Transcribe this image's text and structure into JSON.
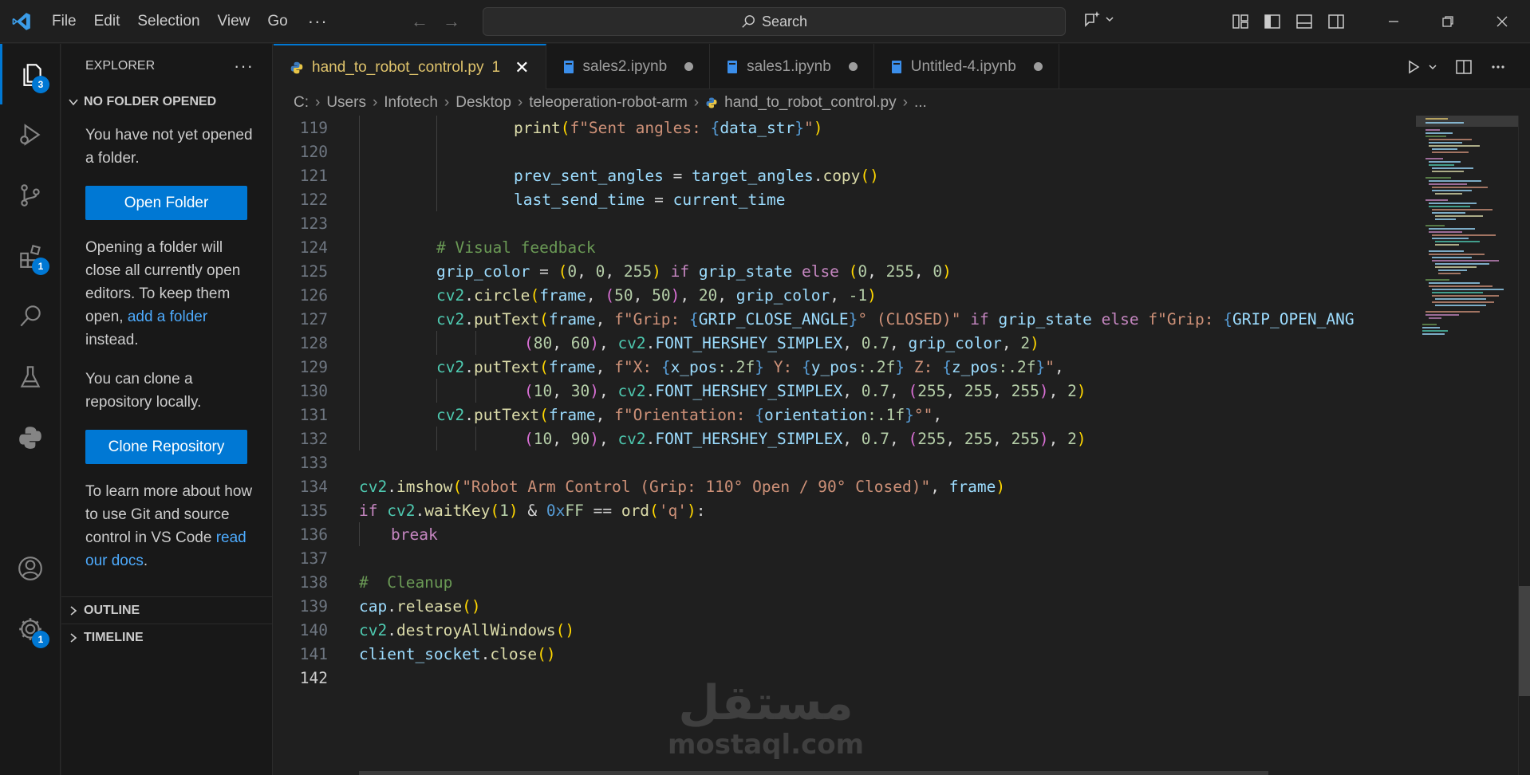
{
  "menu": [
    "File",
    "Edit",
    "Selection",
    "View",
    "Go"
  ],
  "menu_more": "···",
  "search": {
    "label": "Search"
  },
  "activity": {
    "explorer_badge": "3",
    "extensions_badge": "1",
    "manage_badge": "1"
  },
  "sidebar": {
    "title": "EXPLORER",
    "more": "···",
    "section": "NO FOLDER OPENED",
    "msg1": "You have not yet opened a folder.",
    "open_folder": "Open Folder",
    "msg2_a": "Opening a folder will close all currently open editors. To keep them open, ",
    "msg2_link": "add a folder",
    "msg2_b": " instead.",
    "msg3": "You can clone a repository locally.",
    "clone": "Clone Repository",
    "msg4_a": "To learn more about how to use Git and source control in VS Code ",
    "msg4_link": "read our docs",
    "msg4_b": ".",
    "outline": "OUTLINE",
    "timeline": "TIMELINE"
  },
  "tabs": [
    {
      "label": "hand_to_robot_control.py",
      "num": "1",
      "close": "✕"
    },
    {
      "label": "sales2.ipynb"
    },
    {
      "label": "sales1.ipynb"
    },
    {
      "label": "Untitled-4.ipynb"
    }
  ],
  "breadcrumb": [
    "C:",
    "Users",
    "Infotech",
    "Desktop",
    "teleoperation-robot-arm",
    "hand_to_robot_control.py",
    "..."
  ],
  "line_numbers": [
    "119",
    "120",
    "121",
    "122",
    "123",
    "124",
    "125",
    "126",
    "127",
    "128",
    "129",
    "130",
    "131",
    "132",
    "133",
    "134",
    "135",
    "136",
    "137",
    "138",
    "139",
    "140",
    "141",
    "142"
  ],
  "code": {
    "l119": [
      "print",
      "(",
      "f\"Sent angles: ",
      "{",
      "data_str",
      "}",
      "\"",
      ")"
    ],
    "l121": [
      "prev_sent_angles",
      " = ",
      "target_angles",
      ".",
      "copy",
      "()"
    ],
    "l122": [
      "last_send_time",
      " = ",
      "current_time"
    ],
    "l124": "# Visual feedback",
    "l125": [
      "grip_color",
      " = ",
      "(",
      "0",
      ", ",
      "0",
      ", ",
      "255",
      ")",
      " if ",
      "grip_state",
      " else ",
      "(",
      "0",
      ", ",
      "255",
      ", ",
      "0",
      ")"
    ],
    "l126": [
      "cv2",
      ".",
      "circle",
      "(",
      "frame",
      ", ",
      "(",
      "50",
      ", ",
      "50",
      ")",
      ", ",
      "20",
      ", ",
      "grip_color",
      ", ",
      "-1",
      ")"
    ],
    "l127": [
      "cv2",
      ".",
      "putText",
      "(",
      "frame",
      ", ",
      "f\"Grip: ",
      "{",
      "GRIP_CLOSE_ANGLE",
      "}",
      "° (CLOSED)\"",
      " if ",
      "grip_state",
      " else ",
      "f\"Grip: ",
      "{",
      "GRIP_OPEN_ANG"
    ],
    "l128": [
      "(",
      "80",
      ", ",
      "60",
      ")",
      ", ",
      "cv2",
      ".",
      "FONT_HERSHEY_SIMPLEX",
      ", ",
      "0.7",
      ", ",
      "grip_color",
      ", ",
      "2",
      ")"
    ],
    "l129": [
      "cv2",
      ".",
      "putText",
      "(",
      "frame",
      ", ",
      "f\"X: ",
      "{",
      "x_pos",
      ":.2f",
      "}",
      " Y: ",
      "{",
      "y_pos",
      ":.2f",
      "}",
      " Z: ",
      "{",
      "z_pos",
      ":.2f",
      "}",
      "\"",
      ","
    ],
    "l130": [
      "(",
      "10",
      ", ",
      "30",
      ")",
      ", ",
      "cv2",
      ".",
      "FONT_HERSHEY_SIMPLEX",
      ", ",
      "0.7",
      ", ",
      "(",
      "255",
      ", ",
      "255",
      ", ",
      "255",
      ")",
      ", ",
      "2",
      ")"
    ],
    "l131": [
      "cv2",
      ".",
      "putText",
      "(",
      "frame",
      ", ",
      "f\"Orientation: ",
      "{",
      "orientation",
      ":.1f",
      "}",
      "°\"",
      ","
    ],
    "l132": [
      "(",
      "10",
      ", ",
      "90",
      ")",
      ", ",
      "cv2",
      ".",
      "FONT_HERSHEY_SIMPLEX",
      ", ",
      "0.7",
      ", ",
      "(",
      "255",
      ", ",
      "255",
      ", ",
      "255",
      ")",
      ", ",
      "2",
      ")"
    ],
    "l134": [
      "cv2",
      ".",
      "imshow",
      "(",
      "\"Robot Arm Control (Grip: 110° Open / 90° Closed)\"",
      ", ",
      "frame",
      ")"
    ],
    "l135": [
      "if ",
      "cv2",
      ".",
      "waitKey",
      "(",
      "1",
      ")",
      " & ",
      "0x",
      "FF",
      " == ",
      "ord",
      "(",
      "'q'",
      ")",
      ":"
    ],
    "l136": "break",
    "l138": "#  Cleanup",
    "l139": [
      "cap",
      ".",
      "release",
      "()"
    ],
    "l140": [
      "cv2",
      ".",
      "destroyAllWindows",
      "()"
    ],
    "l141": [
      "client_socket",
      ".",
      "close",
      "()"
    ]
  },
  "watermark": {
    "arabic": "مستقل",
    "latin": "mostaql.com"
  },
  "colors": {
    "accent": "#0078d4",
    "editor_bg": "#1f1f1f",
    "sidebar_bg": "#181818"
  }
}
